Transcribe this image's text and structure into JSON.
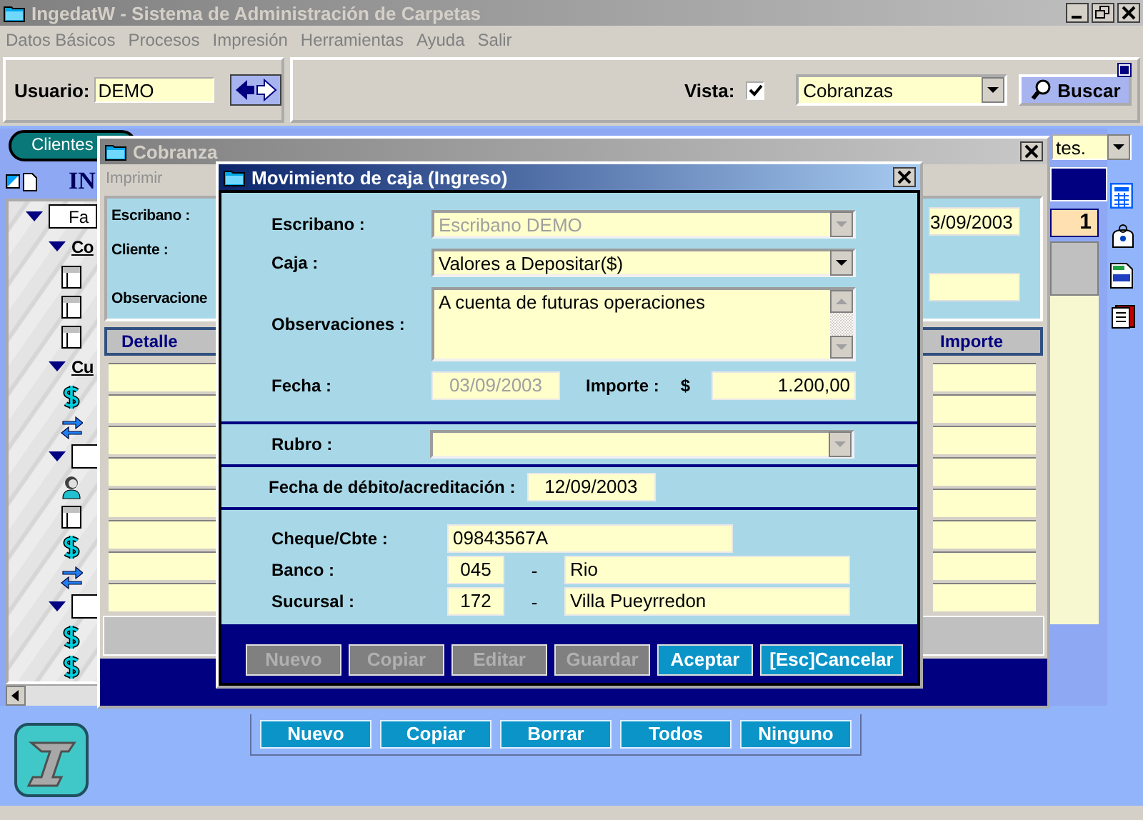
{
  "window": {
    "title": "IngedatW - Sistema de Administración de Carpetas"
  },
  "menu": [
    "Datos Básicos",
    "Procesos",
    "Impresión",
    "Herramientas",
    "Ayuda",
    "Salir"
  ],
  "toolbar": {
    "user_label": "Usuario:",
    "user": "DEMO",
    "vista_label": "Vista:",
    "vista_checked": true,
    "vista": "Cobranzas",
    "search_button": "Buscar"
  },
  "back_window": {
    "tabs": [
      {
        "label": "Clientes",
        "selected": true
      }
    ],
    "header": "IN",
    "combo": "tes.",
    "counter": "1",
    "tree": [
      {
        "kind": "box",
        "label": "Fa",
        "expanded": true,
        "children": [
          {
            "kind": "link",
            "label": "Co",
            "expanded": true,
            "children": [
              {
                "kind": "window"
              },
              {
                "kind": "window"
              },
              {
                "kind": "window"
              }
            ]
          },
          {
            "kind": "link",
            "label": "Cu",
            "expanded": true,
            "children": [
              {
                "kind": "dollar"
              },
              {
                "kind": "transfer"
              }
            ]
          },
          {
            "kind": "box",
            "expanded": true,
            "children": [
              {
                "kind": "person"
              },
              {
                "kind": "window"
              },
              {
                "kind": "dollar"
              },
              {
                "kind": "transfer"
              }
            ]
          },
          {
            "kind": "box",
            "expanded": true,
            "children": [
              {
                "kind": "dollar"
              },
              {
                "kind": "dollar"
              }
            ]
          }
        ]
      }
    ]
  },
  "cobranza": {
    "title": "Cobranza",
    "menu": [
      "Imprimir"
    ],
    "labels": [
      "Escribano :",
      "Cliente :",
      "Observacione"
    ],
    "date": "3/09/2003",
    "columns": [
      "Detalle",
      "Importe"
    ]
  },
  "dialog": {
    "title": "Movimiento de caja (Ingreso)",
    "escribano": {
      "label": "Escribano :",
      "value": "Escribano DEMO",
      "disabled": true
    },
    "caja": {
      "label": "Caja :",
      "value": "Valores a Depositar($)",
      "disabled": false
    },
    "observaciones": {
      "label": "Observaciones :",
      "value": "A cuenta de futuras operaciones"
    },
    "fecha": {
      "label": "Fecha :",
      "value": "03/09/2003",
      "disabled": true
    },
    "importe": {
      "label": "Importe :",
      "currency": "$",
      "value": "1.200,00"
    },
    "rubro": {
      "label": "Rubro :",
      "disabled": true
    },
    "fecha_debito": {
      "label": "Fecha de débito/acreditación :",
      "value": "12/09/2003"
    },
    "cheque": {
      "label": "Cheque/Cbte :",
      "value": "09843567A"
    },
    "banco": {
      "label": "Banco :",
      "code": "045",
      "separator": "-",
      "name": "Rio"
    },
    "sucursal": {
      "label": "Sucursal :",
      "code": "172",
      "separator": "-",
      "name": "Villa Pueyrredon"
    },
    "buttons": [
      {
        "label": "Nuevo",
        "disabled": true
      },
      {
        "label": "Copiar",
        "disabled": true
      },
      {
        "label": "Editar",
        "disabled": true
      },
      {
        "label": "Guardar",
        "disabled": true
      },
      {
        "label": "Aceptar",
        "disabled": false
      },
      {
        "label": "[Esc]Cancelar",
        "disabled": false
      }
    ]
  },
  "bottom_buttons": [
    "Nuevo",
    "Copiar",
    "Borrar",
    "Todos",
    "Ninguno"
  ]
}
